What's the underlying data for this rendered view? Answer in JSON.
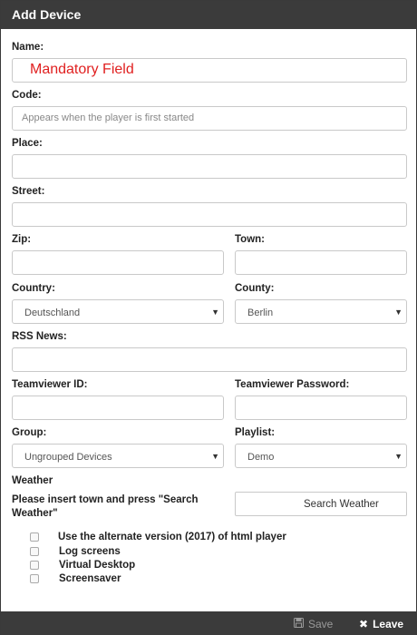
{
  "dialog": {
    "title": "Add Device"
  },
  "fields": {
    "name": {
      "label": "Name:",
      "value": "Mandatory Field"
    },
    "code": {
      "label": "Code:",
      "placeholder": "Appears when the player is first started"
    },
    "place": {
      "label": "Place:",
      "value": ""
    },
    "street": {
      "label": "Street:",
      "value": ""
    },
    "zip": {
      "label": "Zip:",
      "value": ""
    },
    "town": {
      "label": "Town:",
      "value": ""
    },
    "country": {
      "label": "Country:",
      "value": "Deutschland"
    },
    "county": {
      "label": "County:",
      "value": "Berlin"
    },
    "rss": {
      "label": "RSS News:",
      "value": ""
    },
    "teamviewer_id": {
      "label": "Teamviewer ID:",
      "value": ""
    },
    "teamviewer_password": {
      "label": "Teamviewer Password:",
      "value": ""
    },
    "group": {
      "label": "Group:",
      "value": "Ungrouped Devices"
    },
    "playlist": {
      "label": "Playlist:",
      "value": "Demo"
    }
  },
  "weather": {
    "heading": "Weather",
    "instruction": "Please insert town and press \"Search Weather\"",
    "button_label": "Search Weather"
  },
  "options": [
    {
      "label": "Use the alternate version (2017) of html player",
      "checked": false
    },
    {
      "label": "Log screens",
      "checked": false
    },
    {
      "label": "Virtual Desktop",
      "checked": false
    },
    {
      "label": "Screensaver",
      "checked": false
    }
  ],
  "footer": {
    "save_label": "Save",
    "leave_label": "Leave",
    "save_icon": "floppy-disk-icon",
    "leave_icon": "x-mark-icon"
  },
  "colors": {
    "header_bg": "#3b3b3b",
    "mandatory_text": "#e02020",
    "save_text": "#9a9a9a",
    "leave_text": "#ffffff"
  }
}
